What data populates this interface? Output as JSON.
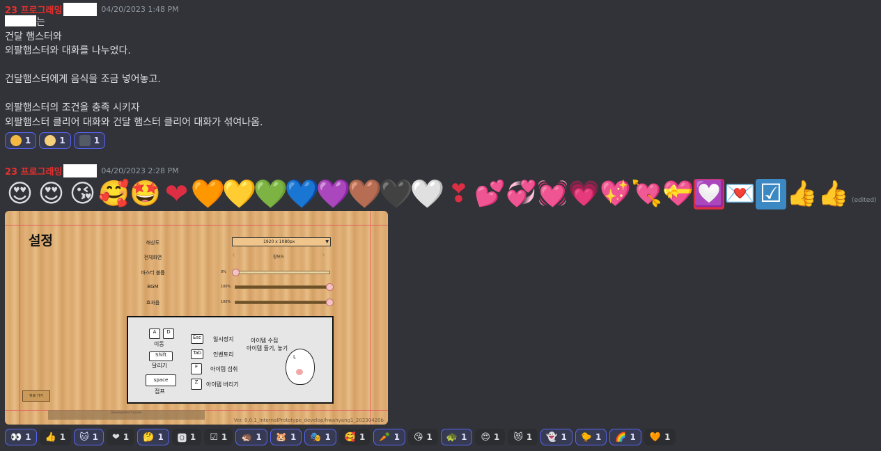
{
  "messages": [
    {
      "username": "23 프로그래밍",
      "timestamp": "04/20/2023 1:48 PM",
      "first_line_suffix": "는",
      "lines": [
        "건달 햄스터와",
        "외팔햄스터와 대화를 나누었다.",
        "",
        "건달햄스터에게 음식을 조금 넣어놓고.",
        "",
        "외팔햄스터의 조건을 충족 시키자",
        "외팔햄스터 클리어 대화와 건달 햄스터 클리어 대화가 섞여나옴."
      ],
      "reactions": [
        {
          "emoji": "mind-blown-face",
          "count": "1",
          "active": true
        },
        {
          "emoji": "hamster-face",
          "count": "1",
          "active": true
        },
        {
          "emoji": "anime-character",
          "count": "1",
          "active": true
        }
      ]
    },
    {
      "username": "23 프로그래밍",
      "timestamp": "04/20/2023 2:28 PM",
      "edited": "(edited)",
      "big_emojis": [
        "😍",
        "😍",
        "😘",
        "🥰",
        "🤩",
        "❤",
        "🧡",
        "💛",
        "💚",
        "💙",
        "💜",
        "🤎",
        "🖤",
        "🤍",
        "❣",
        "💕",
        "💞",
        "💓",
        "💗",
        "💖",
        "💘",
        "💝",
        "💟",
        "💌",
        "☑",
        "👍",
        "👍"
      ],
      "screenshot": {
        "title": "설정",
        "labels": [
          "해상도",
          "전체화면",
          "마스터 볼륨",
          "BGM",
          "효과음"
        ],
        "resolution": "1920 x 1080px",
        "fullscreen": "창모드",
        "master_pct": "0%",
        "bgm_pct": "100%",
        "sfx_pct": "100%",
        "master_level": 0,
        "bgm_level": 1,
        "sfx_level": 1,
        "keys": {
          "a": "A",
          "d": "D",
          "move": "이동",
          "shift": "Shift",
          "run": "달리기",
          "space": "space",
          "jump": "점프",
          "esc": "Esc",
          "pause": "일시정지",
          "tab": "Tab",
          "inventory": "인벤토리",
          "f": "F",
          "eat": "아이템 섭취",
          "z": "Z",
          "drop": "아이템 버리기",
          "collect": "아이템 수집",
          "hold": "아이템 들기, 놓기",
          "mouse_l": "L"
        },
        "back": "뒤로 가기",
        "console": "Development Console",
        "version": "Ver. 0.0.1_InternalPrototype_develop/hwahyang1_20230420b"
      },
      "reactions": [
        {
          "emoji": "👀",
          "count": "1",
          "active": true
        },
        {
          "emoji": "👍",
          "count": "1",
          "active": false
        },
        {
          "emoji": "🐱",
          "count": "1",
          "active": true
        },
        {
          "emoji": "❤",
          "count": "1",
          "active": false
        },
        {
          "emoji": "🤔",
          "count": "1",
          "active": true
        },
        {
          "emoji": "🅾",
          "count": "1",
          "active": false
        },
        {
          "emoji": "☑",
          "count": "1",
          "active": false
        },
        {
          "emoji": "🦔",
          "count": "1",
          "active": true
        },
        {
          "emoji": "🐹",
          "count": "1",
          "active": true
        },
        {
          "emoji": "🎭",
          "count": "1",
          "active": true
        },
        {
          "emoji": "🥰",
          "count": "1",
          "active": false
        },
        {
          "emoji": "🥕",
          "count": "1",
          "active": true
        },
        {
          "emoji": "😘",
          "count": "1",
          "active": false
        },
        {
          "emoji": "🐢",
          "count": "1",
          "active": true
        },
        {
          "emoji": "😍",
          "count": "1",
          "active": false
        },
        {
          "emoji": "😻",
          "count": "1",
          "active": false
        },
        {
          "emoji": "👻",
          "count": "1",
          "active": true
        },
        {
          "emoji": "🐤",
          "count": "1",
          "active": true
        },
        {
          "emoji": "🌈",
          "count": "1",
          "active": true
        },
        {
          "emoji": "🧡",
          "count": "1",
          "active": false
        }
      ]
    }
  ]
}
